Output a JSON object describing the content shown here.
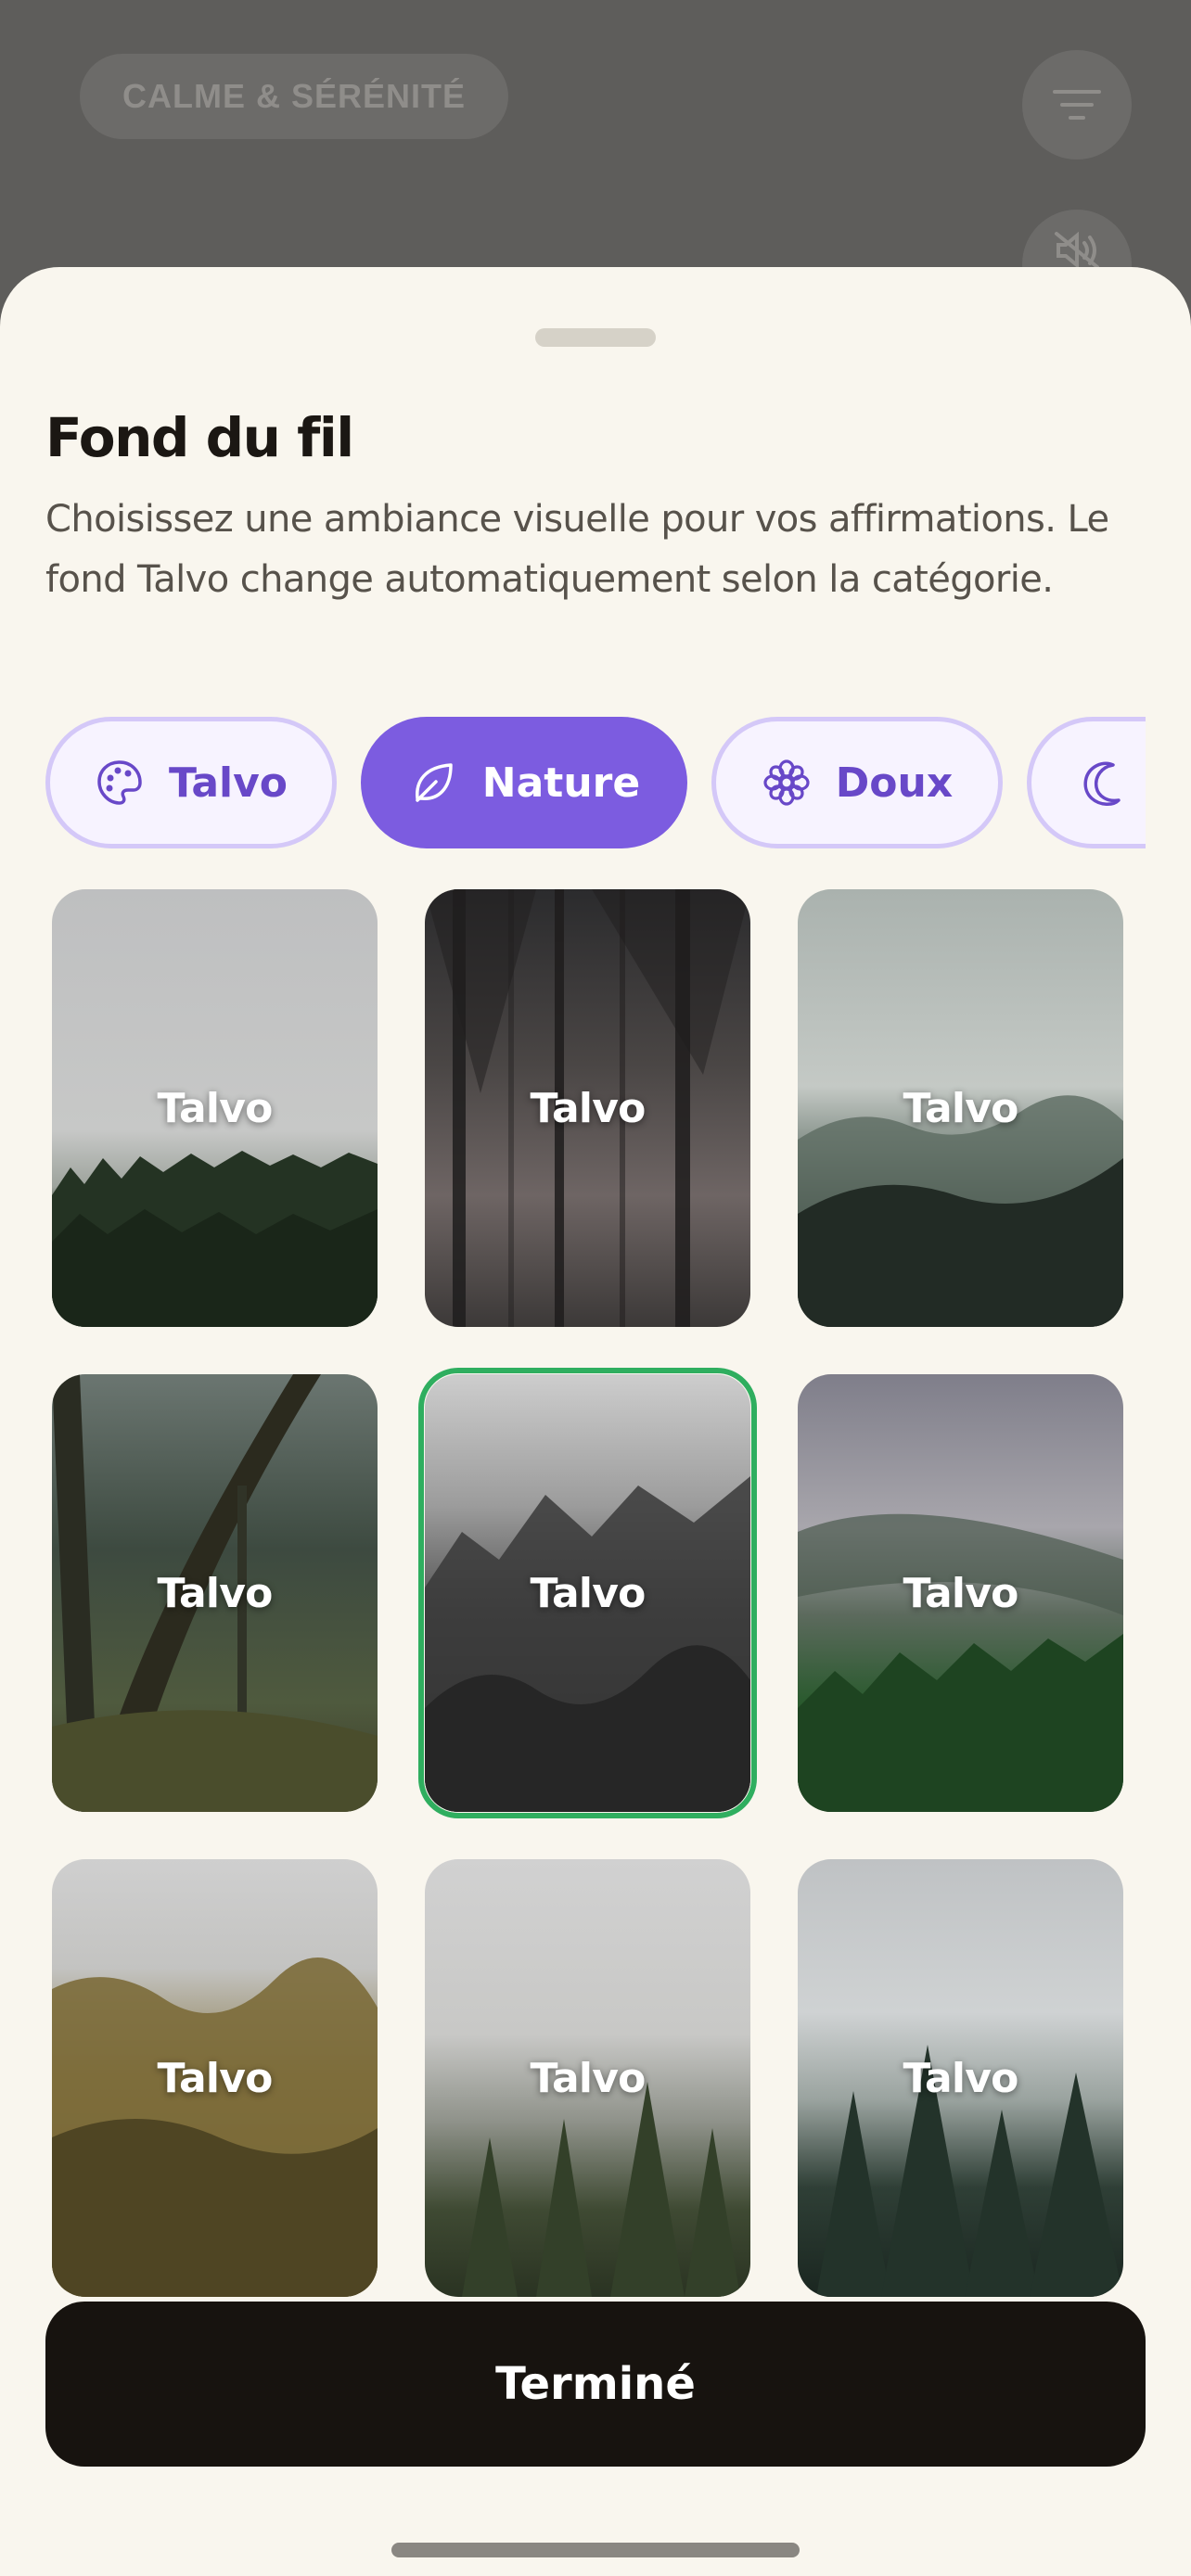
{
  "background_app": {
    "category_chip": "CALME & SÉRÉNITÉ",
    "filter_icon": "filter-icon",
    "sound_icon": "sound-off-icon"
  },
  "sheet": {
    "title": "Fond du fil",
    "description": "Choisissez une ambiance visuelle pour vos affirmations. Le fond Talvo change automatiquement selon la catégorie.",
    "tabs": [
      {
        "label": "Talvo",
        "icon": "palette-icon",
        "active": false
      },
      {
        "label": "Nature",
        "icon": "leaf-icon",
        "active": true
      },
      {
        "label": "Doux",
        "icon": "flower-icon",
        "active": false
      },
      {
        "label": "",
        "icon": "moon-icon",
        "active": false
      }
    ],
    "backgrounds": [
      {
        "label": "Talvo",
        "selected": false
      },
      {
        "label": "Talvo",
        "selected": false
      },
      {
        "label": "Talvo",
        "selected": false
      },
      {
        "label": "Talvo",
        "selected": false
      },
      {
        "label": "Talvo",
        "selected": true
      },
      {
        "label": "Talvo",
        "selected": false
      },
      {
        "label": "Talvo",
        "selected": false
      },
      {
        "label": "Talvo",
        "selected": false
      },
      {
        "label": "Talvo",
        "selected": false
      }
    ],
    "done_label": "Terminé"
  },
  "colors": {
    "accent": "#7c5ce0",
    "selected_border": "#2fae5f",
    "sheet_background": "#f9f6ee",
    "button_dark": "#17130f"
  }
}
